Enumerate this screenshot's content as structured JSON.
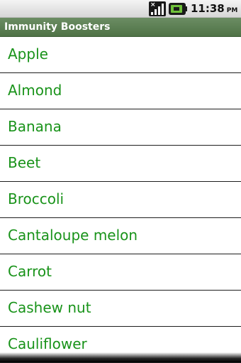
{
  "status_bar": {
    "signal_icon": "signal-no-service-icon",
    "battery_icon": "battery-charging-icon",
    "time": "11:38",
    "ampm": "PM"
  },
  "title_bar": {
    "title": "Immunity Boosters"
  },
  "list": {
    "items": [
      "Apple",
      "Almond",
      "Banana",
      "Beet",
      "Broccoli",
      "Cantaloupe melon",
      "Carrot",
      "Cashew nut",
      "Cauliflower"
    ]
  },
  "colors": {
    "item_text": "#19931a",
    "title_bar": "#5b7f52",
    "divider": "#1e1e1e"
  }
}
